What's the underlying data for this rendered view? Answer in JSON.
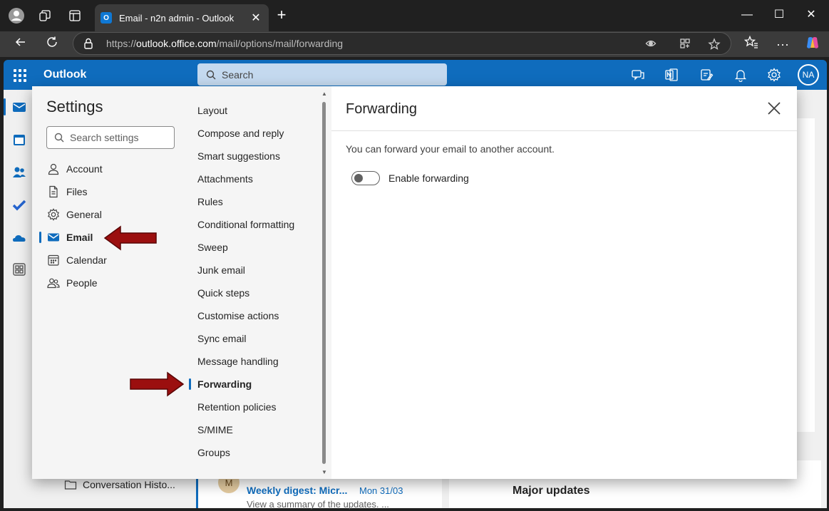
{
  "browser": {
    "tab_title": "Email - n2n admin - Outlook",
    "url_prefix": "https://",
    "url_domain": "outlook.office.com",
    "url_path": "/mail/options/mail/forwarding"
  },
  "outlook": {
    "brand": "Outlook",
    "search_placeholder": "Search",
    "avatar_initials": "NA",
    "brand_color": "#0f6cbd"
  },
  "background": {
    "folder": "Conversation Histo...",
    "message": {
      "avatar": "M",
      "subject": "Weekly digest: Micr...",
      "date": "Mon 31/03",
      "preview": "View a summary of the updates. ..."
    },
    "reading_heading": "Major updates"
  },
  "settings": {
    "title": "Settings",
    "search_placeholder": "Search settings",
    "categories": [
      {
        "label": "Account",
        "icon": "person-icon"
      },
      {
        "label": "Files",
        "icon": "file-icon"
      },
      {
        "label": "General",
        "icon": "gear-icon"
      },
      {
        "label": "Email",
        "icon": "mail-icon",
        "active": true
      },
      {
        "label": "Calendar",
        "icon": "calendar-icon"
      },
      {
        "label": "People",
        "icon": "people-icon"
      }
    ],
    "email_sections": [
      "Layout",
      "Compose and reply",
      "Smart suggestions",
      "Attachments",
      "Rules",
      "Conditional formatting",
      "Sweep",
      "Junk email",
      "Quick steps",
      "Customise actions",
      "Sync email",
      "Message handling",
      "Forwarding",
      "Retention policies",
      "S/MIME",
      "Groups"
    ],
    "active_section": "Forwarding",
    "panel": {
      "title": "Forwarding",
      "description": "You can forward your email to another account.",
      "toggle_label": "Enable forwarding",
      "toggle_on": false
    }
  }
}
